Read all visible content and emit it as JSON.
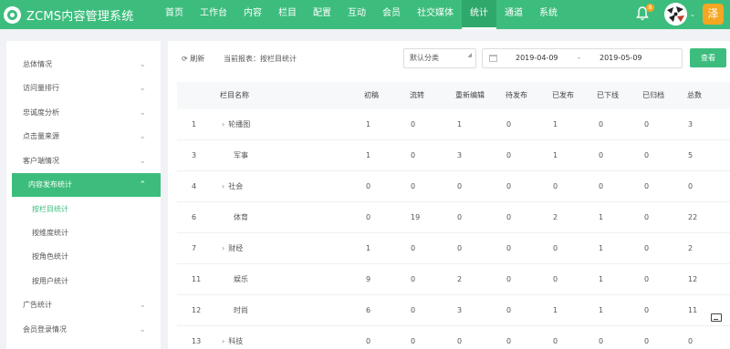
{
  "app": {
    "logo_text": "ZCMS内容管理系统"
  },
  "nav": [
    {
      "label": "首页"
    },
    {
      "label": "工作台"
    },
    {
      "label": "内容"
    },
    {
      "label": "栏目"
    },
    {
      "label": "配置"
    },
    {
      "label": "互动"
    },
    {
      "label": "会员"
    },
    {
      "label": "社交媒体"
    },
    {
      "label": "统计",
      "active": true
    },
    {
      "label": "通道"
    },
    {
      "label": "系统"
    }
  ],
  "header": {
    "notification_count": "8",
    "user_initial": "泽"
  },
  "sidebar": {
    "items": [
      {
        "label": "总体情况"
      },
      {
        "label": "访问量排行"
      },
      {
        "label": "忠诚度分析"
      },
      {
        "label": "点击量来源"
      },
      {
        "label": "客户端情况"
      },
      {
        "label": "内容发布统计"
      },
      {
        "label": "广告统计"
      },
      {
        "label": "会员登录情况"
      }
    ],
    "subitems": [
      {
        "label": "按栏目统计"
      },
      {
        "label": "按维度统计"
      },
      {
        "label": "按角色统计"
      },
      {
        "label": "按用户统计"
      }
    ]
  },
  "toolbar": {
    "refresh_label": "刷新",
    "report_label": "当前报表：按栏目统计",
    "category_value": "默认分类",
    "date_start": "2019-04-09",
    "date_sep": "-",
    "date_end": "2019-05-09",
    "search_label": "查看"
  },
  "table": {
    "headers": [
      "栏目名称",
      "初稿",
      "流转",
      "重新编辑",
      "待发布",
      "已发布",
      "已下线",
      "已归档",
      "总数"
    ],
    "rows": [
      {
        "id": "1",
        "name": "轮播图",
        "expandable": true,
        "cells": [
          "1",
          "0",
          "1",
          "0",
          "1",
          "0",
          "0",
          "3"
        ]
      },
      {
        "id": "3",
        "name": "军事",
        "expandable": false,
        "cells": [
          "1",
          "0",
          "3",
          "0",
          "1",
          "0",
          "0",
          "5"
        ]
      },
      {
        "id": "4",
        "name": "社会",
        "expandable": true,
        "cells": [
          "0",
          "0",
          "0",
          "0",
          "0",
          "0",
          "0",
          "0"
        ]
      },
      {
        "id": "6",
        "name": "体育",
        "expandable": false,
        "cells": [
          "0",
          "19",
          "0",
          "0",
          "2",
          "1",
          "0",
          "22"
        ]
      },
      {
        "id": "7",
        "name": "财经",
        "expandable": true,
        "cells": [
          "1",
          "0",
          "0",
          "0",
          "0",
          "1",
          "0",
          "2"
        ]
      },
      {
        "id": "11",
        "name": "娱乐",
        "expandable": false,
        "cells": [
          "9",
          "0",
          "2",
          "0",
          "0",
          "1",
          "0",
          "12"
        ]
      },
      {
        "id": "12",
        "name": "时尚",
        "expandable": false,
        "cells": [
          "6",
          "0",
          "3",
          "0",
          "1",
          "1",
          "0",
          "11"
        ]
      },
      {
        "id": "13",
        "name": "科技",
        "expandable": true,
        "cells": [
          "0",
          "0",
          "0",
          "0",
          "0",
          "0",
          "0",
          "0"
        ]
      }
    ]
  },
  "icons": {
    "refresh": "refresh-icon",
    "bell": "bell-icon",
    "calendar": "calendar-icon",
    "chevron": "chevron-down-icon",
    "expand": "chevron-right-icon",
    "inbox": "inbox-icon"
  },
  "colors": {
    "brand": "#3dbd7d",
    "badge": "#f5a623"
  }
}
